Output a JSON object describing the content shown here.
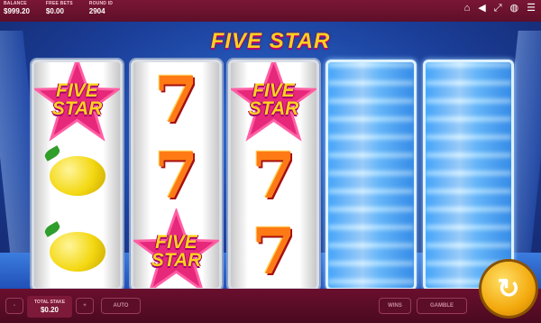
{
  "header": {
    "stats": [
      {
        "label": "BALANCE",
        "value": "$999.20"
      },
      {
        "label": "FREE BETS",
        "value": "$0.00"
      },
      {
        "label": "ROUND ID",
        "value": "2904"
      }
    ],
    "icons": [
      "home-icon",
      "sound-icon",
      "fullscreen-icon",
      "settings-icon",
      "menu-icon"
    ]
  },
  "game": {
    "logo": "FIVE STAR",
    "star_symbol_text": {
      "line1": "FIVE",
      "line2": "STAR"
    },
    "seven_symbol": "7",
    "reels": [
      {
        "symbols": [
          "five-star",
          "lemon",
          "lemon"
        ],
        "spinning": false
      },
      {
        "symbols": [
          "seven",
          "seven",
          "five-star"
        ],
        "spinning": false
      },
      {
        "symbols": [
          "five-star",
          "seven",
          "seven"
        ],
        "spinning": false
      },
      {
        "symbols": [],
        "spinning": true
      },
      {
        "symbols": [],
        "spinning": true
      }
    ]
  },
  "footer": {
    "minus": "-",
    "plus": "+",
    "stake_label": "TOTAL STAKE",
    "stake_value": "$0.20",
    "auto_label": "AUTO",
    "wins_label": "WINS",
    "gamble_label": "GAMBLE"
  },
  "colors": {
    "accent": "#ffcf1f",
    "bar": "#6a0f2e",
    "stage": "#2f6fd6"
  }
}
